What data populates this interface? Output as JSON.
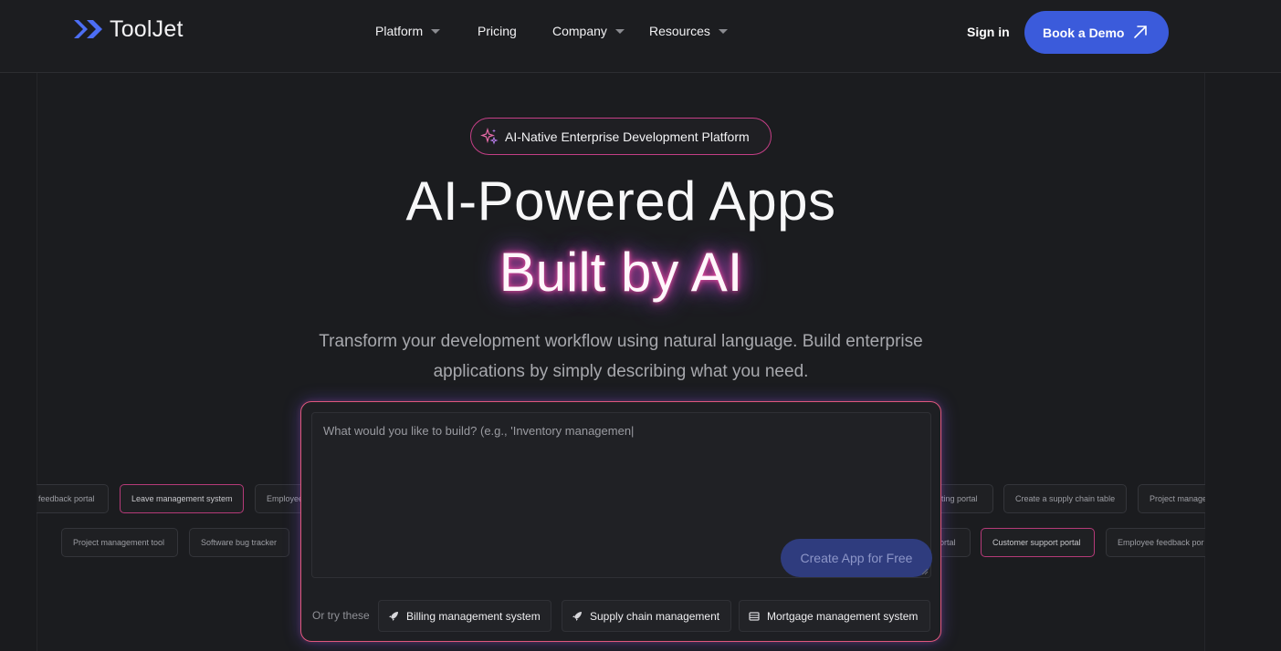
{
  "header": {
    "logo_text": "ToolJet",
    "nav": [
      {
        "label": "Platform",
        "has_dropdown": true
      },
      {
        "label": "Pricing",
        "has_dropdown": false
      },
      {
        "label": "Company",
        "has_dropdown": true
      },
      {
        "label": "Resources",
        "has_dropdown": true
      }
    ],
    "sign_in": "Sign in",
    "demo_button": "Book a Demo"
  },
  "hero": {
    "badge": "AI-Native Enterprise Development Platform",
    "title_line1": "AI-Powered Apps",
    "title_line2": "Built by AI",
    "subtitle": "Transform your development workflow using natural language. Build enterprise applications by simply describing what you need."
  },
  "tags": {
    "row1_left": [
      "feedback portal",
      "Leave management system",
      "Employee"
    ],
    "row1_right": [
      "iting portal",
      "Create a supply chain table",
      "Project manage"
    ],
    "row2_left": [
      "Project management tool",
      "Software bug tracker"
    ],
    "row2_right": [
      "ortal",
      "Customer support portal",
      "Employee feedback por"
    ]
  },
  "prompt": {
    "placeholder": "What would you like to build? (e.g., 'Inventory managemen|",
    "create_button": "Create App for Free",
    "try_label": "Or try these",
    "suggestions": [
      {
        "label": "Billing management system",
        "icon": "rocket-icon"
      },
      {
        "label": "Supply chain management",
        "icon": "rocket-icon"
      },
      {
        "label": "Mortgage management system",
        "icon": "table-icon"
      }
    ]
  },
  "colors": {
    "accent_blue": "#3b5bdb",
    "glow_pink": "#e0577d",
    "background": "#1a1b1e"
  }
}
